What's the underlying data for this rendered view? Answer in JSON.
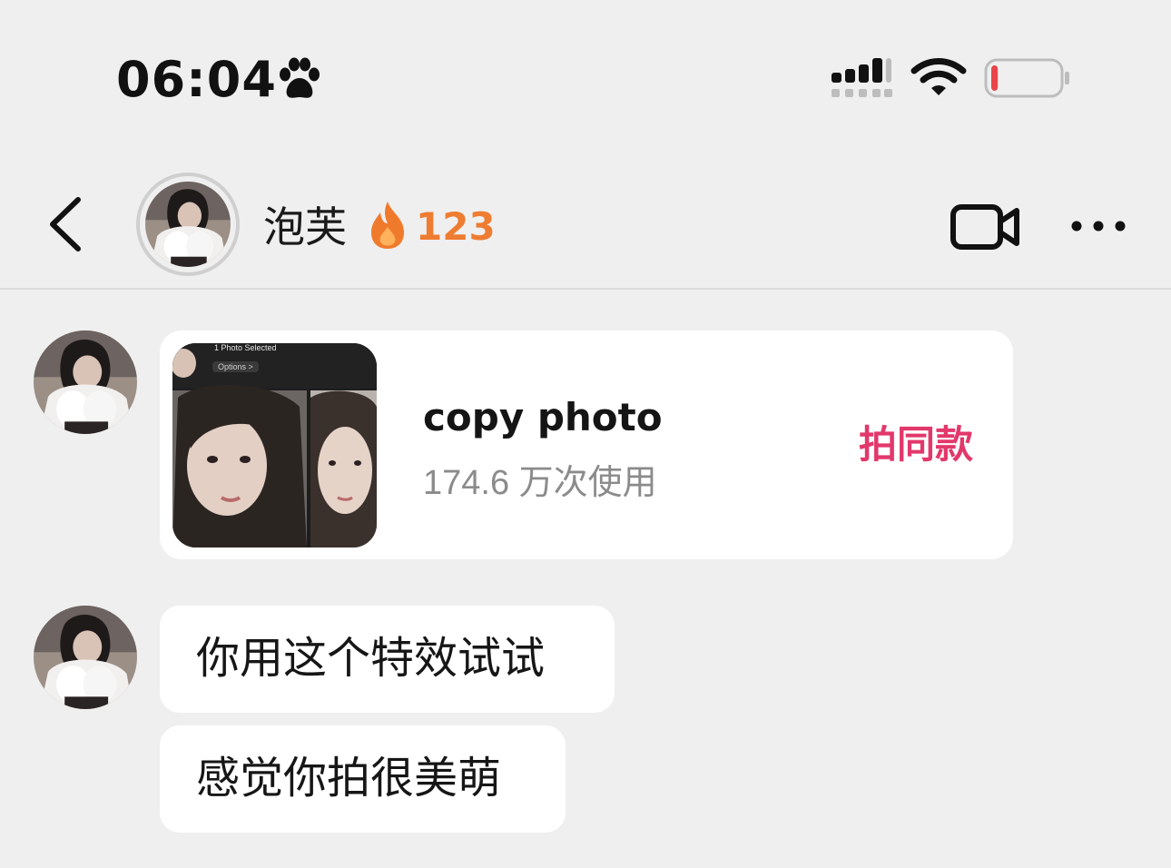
{
  "status_bar": {
    "time": "06:04",
    "paw_icon": "paw-icon",
    "signal_icon": "cellular-signal-icon",
    "wifi_icon": "wifi-icon",
    "battery_icon": "battery-low-icon",
    "battery_level": 0.1,
    "battery_color": "#e8444a"
  },
  "header": {
    "back_icon": "chevron-left-icon",
    "contact_name": "泡芙",
    "streak_icon": "fire-icon",
    "streak_count": "123",
    "streak_color": "#ee7c31",
    "video_icon": "video-camera-icon",
    "more_icon": "more-horizontal-icon"
  },
  "messages": {
    "effect_card": {
      "thumbnail_text_top": "1 Photo Selected",
      "thumbnail_text_options": "Options >",
      "title": "copy photo",
      "usage": "174.6 万次使用",
      "action_label": "拍同款",
      "action_color": "#e2386b"
    },
    "text_1": "你用这个特效试试",
    "text_2": "感觉你拍很美萌"
  }
}
